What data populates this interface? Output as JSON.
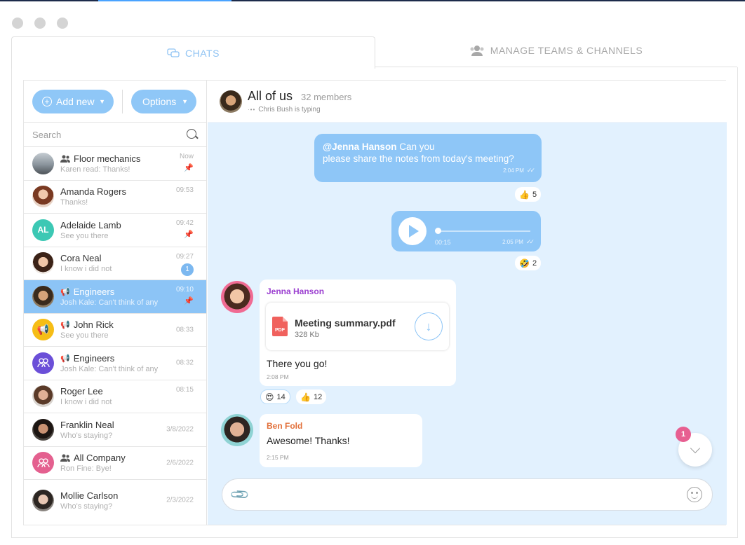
{
  "tabs": {
    "chats": "CHATS",
    "manage": "MANAGE TEAMS & CHANNELS"
  },
  "sidebar": {
    "add_new": "Add new",
    "options": "Options",
    "search_placeholder": "Search",
    "conversations": [
      {
        "name": "Floor mechanics",
        "preview": "Karen read: Thanks!",
        "time": "Now",
        "pinned": true,
        "type": "group",
        "avatar_color": "#6d7a86"
      },
      {
        "name": "Amanda Rogers",
        "preview": "Thanks!",
        "time": "09:53",
        "pinned": false,
        "type": "person",
        "avatar_color": "#a36a55"
      },
      {
        "name": "Adelaide Lamb",
        "preview": "See you there",
        "time": "09:42",
        "pinned": true,
        "type": "person",
        "avatar_initials": "AL",
        "avatar_color": "#3cc8b4"
      },
      {
        "name": "Cora Neal",
        "preview": "I know i did not",
        "time": "09:27",
        "unread": "1",
        "type": "person",
        "avatar_color": "#b07b62"
      },
      {
        "name": "Engineers",
        "preview": "Josh Kale: Can't think of any",
        "time": "09:10",
        "pinned": true,
        "type": "channel",
        "active": true,
        "avatar_color": "#7a5a3c"
      },
      {
        "name": "John Rick",
        "preview": "See you there",
        "time": "08:33",
        "type": "channel",
        "avatar_color": "#f6bd16"
      },
      {
        "name": "Engineers",
        "preview": "Josh Kale: Can't think of any",
        "time": "08:32",
        "type": "channel",
        "avatar_color": "#6b4fd8"
      },
      {
        "name": "Roger Lee",
        "preview": "I know i did not",
        "time": "08:15",
        "type": "person",
        "avatar_color": "#8a6a55"
      },
      {
        "name": "Franklin Neal",
        "preview": "Who's staying?",
        "time": "3/8/2022",
        "type": "person",
        "avatar_color": "#3d3a37"
      },
      {
        "name": "All Company",
        "preview": "Ron Fine: Bye!",
        "time": "2/6/2022",
        "type": "group",
        "avatar_color": "#e4608f"
      },
      {
        "name": "Mollie Carlson",
        "preview": "Who's staying?",
        "time": "2/3/2022",
        "type": "person",
        "avatar_color": "#5d5754"
      }
    ]
  },
  "chat": {
    "title": "All of us",
    "members": "32 members",
    "typing": "Chris Bush is typing",
    "messages": {
      "m1": {
        "mention": "@Jenna Hanson",
        "text_a": " Can you",
        "text_b": "please share the notes from  today's meeting?",
        "time": "2:04 PM",
        "reaction_count": "5"
      },
      "m2": {
        "duration": "00:15",
        "time": "2:05 PM",
        "reaction_count": "2"
      },
      "m3": {
        "sender": "Jenna Hanson",
        "sender_color": "#9b3fd0",
        "file_name": "Meeting summary.pdf",
        "file_size": "328 Kb",
        "file_type": "PDF",
        "text": "There you go!",
        "time": "2:08 PM",
        "reaction1_count": "14",
        "reaction2_count": "12"
      },
      "m4": {
        "sender": "Ben Fold",
        "sender_color": "#e2703a",
        "text": "Awesome! Thanks!",
        "time": "2:15 PM"
      }
    },
    "scroll_badge": "1",
    "composer_placeholder": ""
  }
}
